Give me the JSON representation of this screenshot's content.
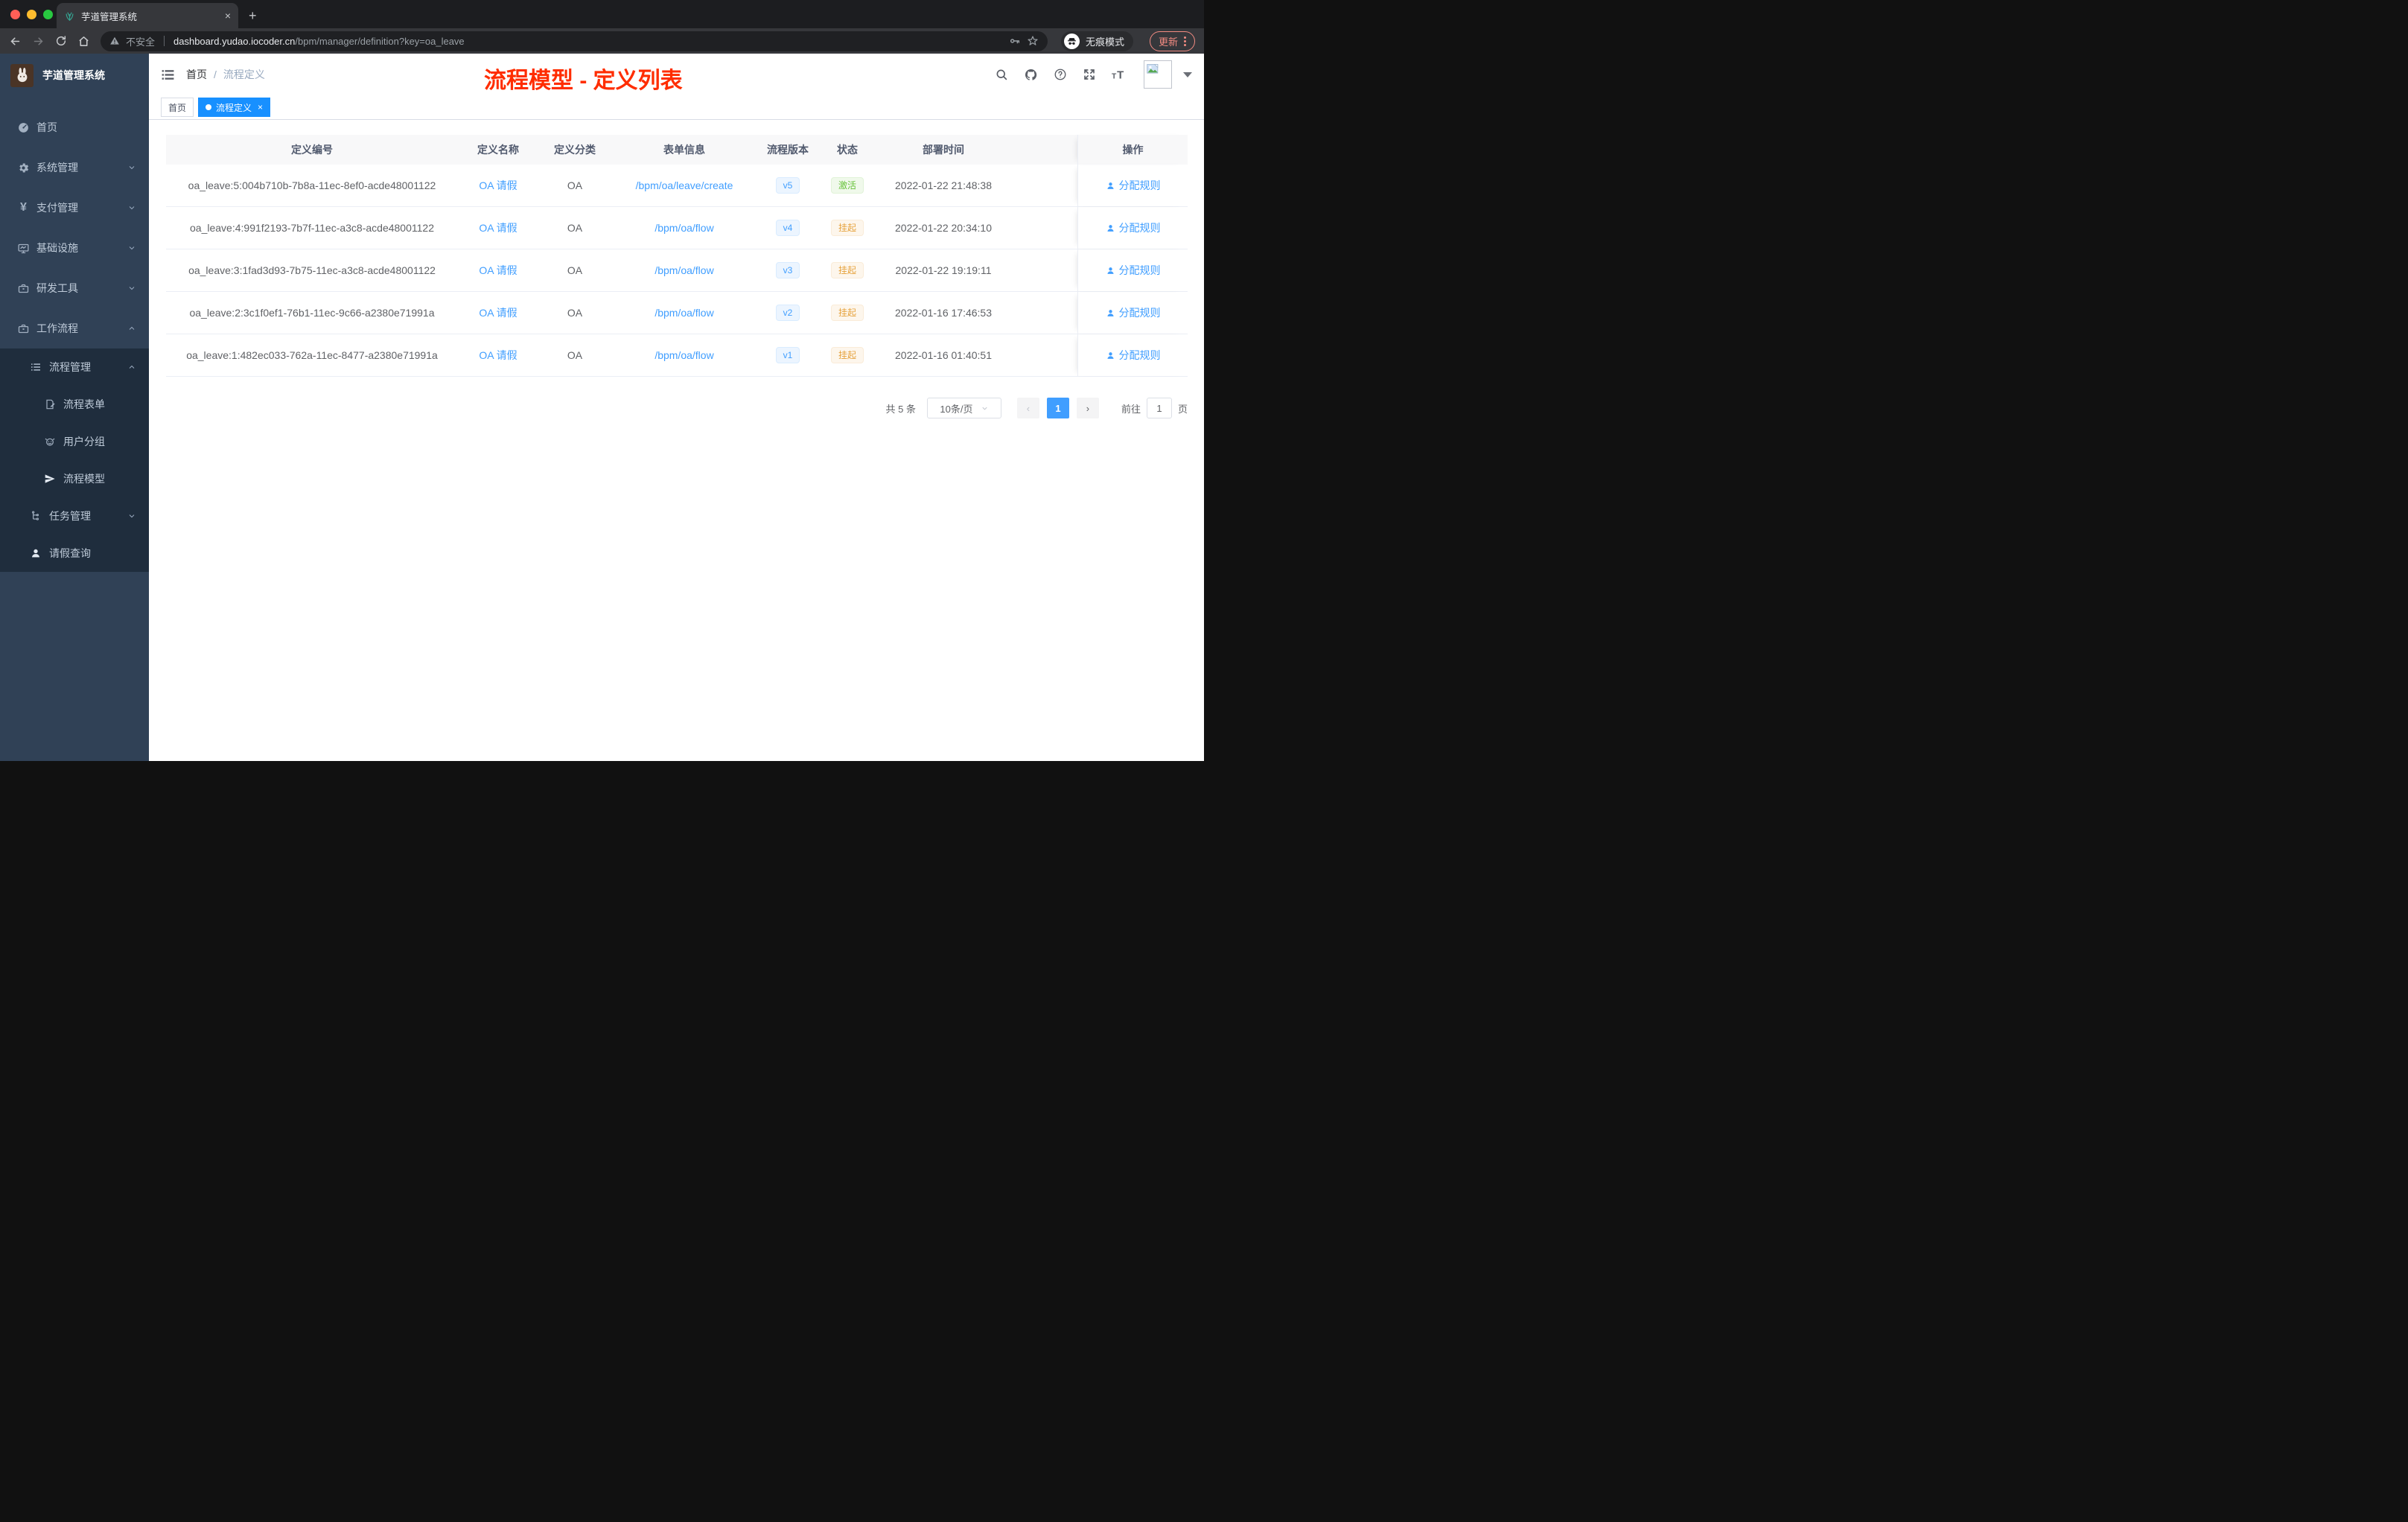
{
  "browser": {
    "tab_title": "芋道管理系统",
    "tab_close": "×",
    "new_tab": "+",
    "security_label": "不安全",
    "url_host": "dashboard.yudao.iocoder.cn",
    "url_path": "/bpm/manager/definition?key=oa_leave",
    "incognito_label": "无痕模式",
    "update_label": "更新"
  },
  "sidebar": {
    "title": "芋道管理系统",
    "items": [
      {
        "label": "首页"
      },
      {
        "label": "系统管理"
      },
      {
        "label": "支付管理"
      },
      {
        "label": "基础设施"
      },
      {
        "label": "研发工具"
      },
      {
        "label": "工作流程"
      },
      {
        "label": "流程管理"
      },
      {
        "label": "流程表单"
      },
      {
        "label": "用户分组"
      },
      {
        "label": "流程模型"
      },
      {
        "label": "任务管理"
      },
      {
        "label": "请假查询"
      }
    ],
    "yen_glyph": "¥"
  },
  "header": {
    "breadcrumb_home": "首页",
    "breadcrumb_sep": "/",
    "breadcrumb_current": "流程定义",
    "annotation": "流程模型 - 定义列表"
  },
  "tags": {
    "home": "首页",
    "active": "流程定义",
    "active_close": "×"
  },
  "table": {
    "columns": {
      "id": "定义编号",
      "name": "定义名称",
      "category": "定义分类",
      "form": "表单信息",
      "version": "流程版本",
      "status": "状态",
      "deploy_time": "部署时间",
      "actions": "操作"
    },
    "action_label": "分配规则",
    "rows": [
      {
        "id": "oa_leave:5:004b710b-7b8a-11ec-8ef0-acde48001122",
        "name": "OA 请假",
        "category": "OA",
        "form": "/bpm/oa/leave/create",
        "version": "v5",
        "status": "激活",
        "time": "2022-01-22 21:48:38"
      },
      {
        "id": "oa_leave:4:991f2193-7b7f-11ec-a3c8-acde48001122",
        "name": "OA 请假",
        "category": "OA",
        "form": "/bpm/oa/flow",
        "version": "v4",
        "status": "挂起",
        "time": "2022-01-22 20:34:10"
      },
      {
        "id": "oa_leave:3:1fad3d93-7b75-11ec-a3c8-acde48001122",
        "name": "OA 请假",
        "category": "OA",
        "form": "/bpm/oa/flow",
        "version": "v3",
        "status": "挂起",
        "time": "2022-01-22 19:19:11"
      },
      {
        "id": "oa_leave:2:3c1f0ef1-76b1-11ec-9c66-a2380e71991a",
        "name": "OA 请假",
        "category": "OA",
        "form": "/bpm/oa/flow",
        "version": "v2",
        "status": "挂起",
        "time": "2022-01-16 17:46:53"
      },
      {
        "id": "oa_leave:1:482ec033-762a-11ec-8477-a2380e71991a",
        "name": "OA 请假",
        "category": "OA",
        "form": "/bpm/oa/flow",
        "version": "v1",
        "status": "挂起",
        "time": "2022-01-16 01:40:51"
      }
    ]
  },
  "pagination": {
    "total": "共 5 条",
    "page_size": "10条/页",
    "prev": "‹",
    "current": "1",
    "next": "›",
    "goto_label": "前往",
    "goto_value": "1",
    "page_unit": "页"
  },
  "colors": {
    "accent": "#409eff",
    "tag_active": "#1890ff",
    "annotation_red": "#ff2d00",
    "status_active_green": "#67c23a",
    "status_suspend_amber": "#e6a23c",
    "sidebar_bg": "#304156",
    "sidebar_sub_bg": "#1f2d3d"
  }
}
